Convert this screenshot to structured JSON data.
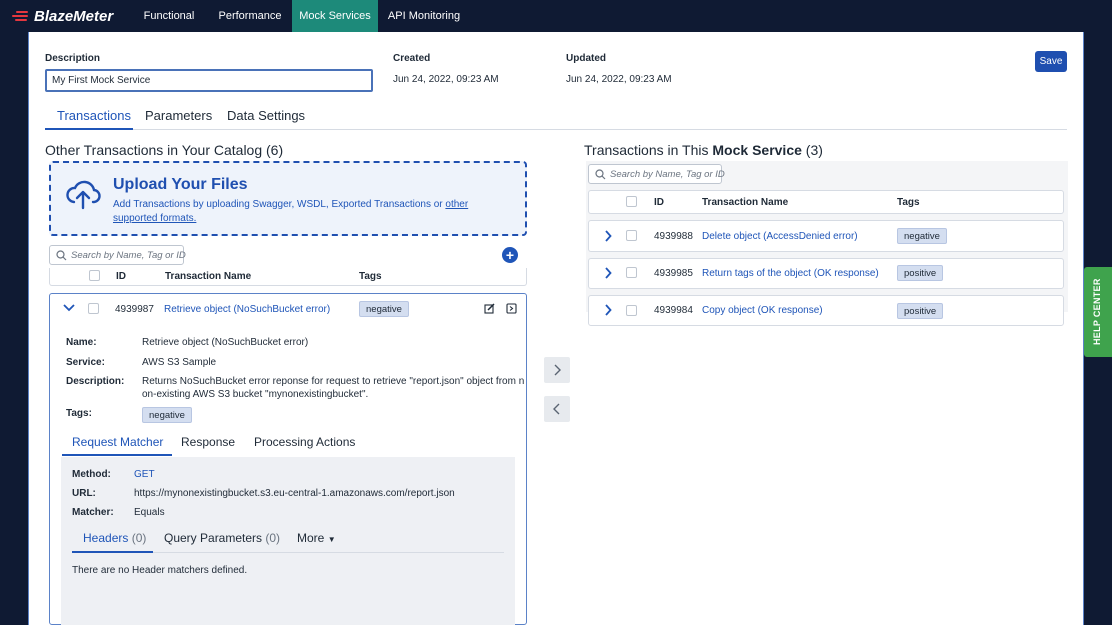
{
  "topnav": {
    "logo": "BlazeMeter",
    "tabs": [
      "Functional",
      "Performance",
      "Mock Services",
      "API Monitoring"
    ],
    "active_tab": "Mock Services"
  },
  "header": {
    "description_label": "Description",
    "description_value": "My First Mock Service",
    "created_label": "Created",
    "created_value": "Jun 24, 2022, 09:23 AM",
    "updated_label": "Updated",
    "updated_value": "Jun 24, 2022, 09:23 AM",
    "save_label": "Save"
  },
  "main_tabs": [
    "Transactions",
    "Parameters",
    "Data Settings"
  ],
  "catalog": {
    "title": "Other Transactions in Your Catalog (6)",
    "upload_title": "Upload Your Files",
    "upload_text": "Add Transactions by uploading Swagger, WSDL, Exported Transactions or ",
    "upload_link": "other supported formats.",
    "search_placeholder": "Search by Name, Tag or ID",
    "columns": {
      "id": "ID",
      "name": "Transaction Name",
      "tags": "Tags"
    },
    "expanded": {
      "id": "4939987",
      "name": "Retrieve object (NoSuchBucket error)",
      "tag": "negative",
      "details": {
        "name_label": "Name:",
        "name_value": "Retrieve object (NoSuchBucket error)",
        "service_label": "Service:",
        "service_value": "AWS S3 Sample",
        "description_label": "Description:",
        "description_line1": "Returns NoSuchBucket error reponse for request to retrieve \"report.json\" object from n",
        "description_line2": "on-existing AWS S3 bucket \"mynonexistingbucket\".",
        "tags_label": "Tags:",
        "tags_value": "negative"
      },
      "sub_tabs": [
        "Request Matcher",
        "Response",
        "Processing Actions"
      ],
      "matcher": {
        "method_label": "Method:",
        "method_value": "GET",
        "url_label": "URL:",
        "url_value": "https://mynonexistingbucket.s3.eu-central-1.amazonaws.com/report.json",
        "matcher_label": "Matcher:",
        "matcher_value": "Equals"
      },
      "inner_tabs": {
        "headers": "Headers",
        "headers_count": "(0)",
        "query": "Query Parameters",
        "query_count": "(0)",
        "more": "More"
      },
      "empty_message": "There are no Header matchers defined."
    }
  },
  "mock_service": {
    "title_prefix": "Transactions in This ",
    "title_bold": "Mock Service",
    "title_suffix": " (3)",
    "search_placeholder": "Search by Name, Tag or ID",
    "columns": {
      "id": "ID",
      "name": "Transaction Name",
      "tags": "Tags"
    },
    "rows": [
      {
        "id": "4939988",
        "name": "Delete object (AccessDenied error)",
        "tag": "negative"
      },
      {
        "id": "4939985",
        "name": "Return tags of the object (OK response)",
        "tag": "positive"
      },
      {
        "id": "4939984",
        "name": "Copy object (OK response)",
        "tag": "positive"
      }
    ]
  },
  "help_center": "HELP CENTER",
  "colors": {
    "nav_bg": "#0f1a33",
    "active_tab": "#1d8a7a",
    "primary": "#1f55b8",
    "help": "#3fa34d"
  },
  "icons": [
    "blazemeter-logo-icon",
    "cloud-upload-icon",
    "search-icon",
    "plus-icon",
    "chevron-down-icon",
    "chevron-right-icon",
    "chevron-left-icon",
    "edit-icon",
    "open-icon",
    "caret-down-icon"
  ]
}
